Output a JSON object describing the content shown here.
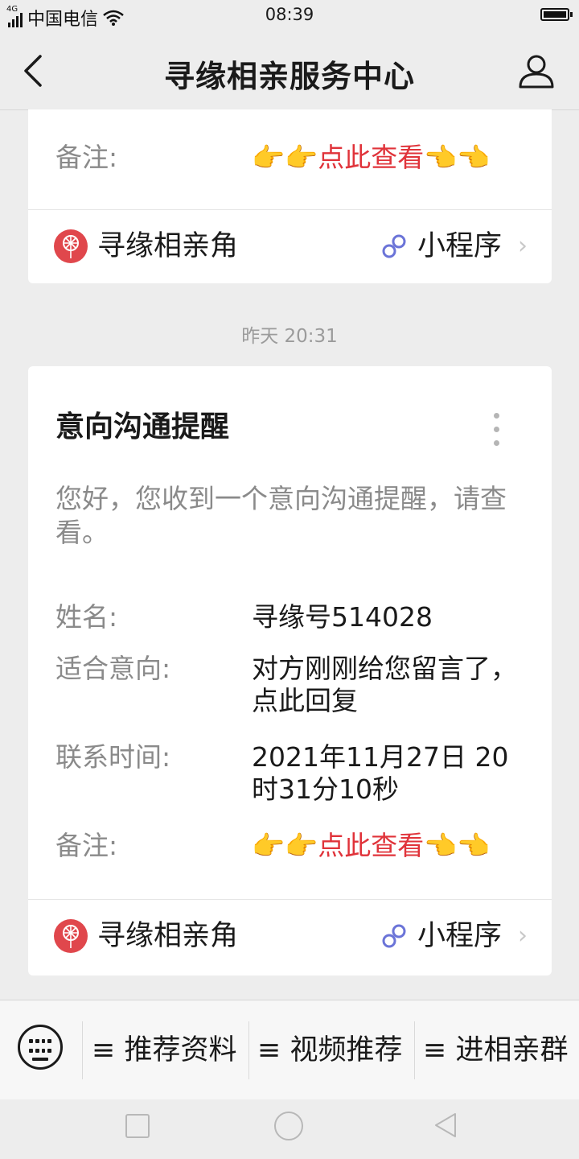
{
  "status_bar": {
    "network": "4G",
    "carrier": "中国电信",
    "time": "08:39"
  },
  "nav": {
    "title": "寻缘相亲服务中心"
  },
  "card1": {
    "note_label": "备注:",
    "note_value": "点此查看",
    "miniprogram_name": "寻缘相亲角",
    "miniprogram_tag": "小程序"
  },
  "timestamp": "昨天 20:31",
  "card2": {
    "title": "意向沟通提醒",
    "intro": "您好，您收到一个意向沟通提醒，请查看。",
    "fields": [
      {
        "label": "姓名:",
        "value": "寻缘号514028"
      },
      {
        "label": "适合意向:",
        "value": "对方刚刚给您留言了，点此回复"
      },
      {
        "label": "联系时间:",
        "value": "2021年11月27日 20时31分10秒"
      },
      {
        "label": "备注:",
        "value": "点此查看"
      }
    ],
    "miniprogram_name": "寻缘相亲角",
    "miniprogram_tag": "小程序"
  },
  "menu": {
    "items": [
      {
        "label": "≡ 推荐资料"
      },
      {
        "label": "≡ 视频推荐"
      },
      {
        "label": "≡ 进相亲群"
      }
    ]
  },
  "colors": {
    "accent_red": "#e0333a",
    "background": "#ededed",
    "card": "#ffffff",
    "muted_text": "#8a8a8a"
  }
}
